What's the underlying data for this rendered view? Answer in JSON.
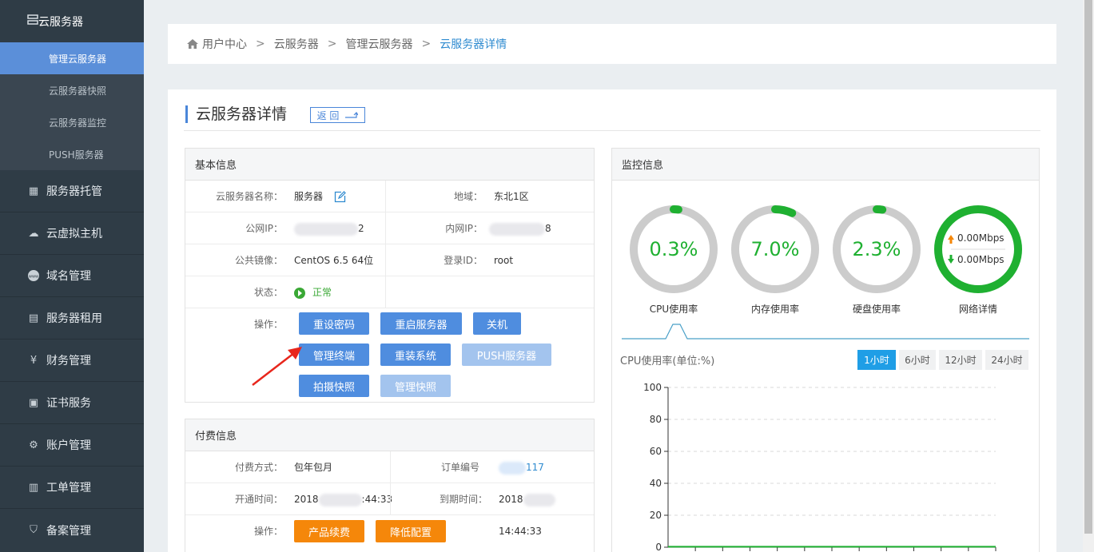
{
  "sidebar": {
    "top": {
      "label": "云服务器",
      "icon": "server-icon"
    },
    "subitems": [
      {
        "label": "管理云服务器",
        "active": true
      },
      {
        "label": "云服务器快照",
        "active": false
      },
      {
        "label": "云服务器监控",
        "active": false
      },
      {
        "label": "PUSH服务器",
        "active": false
      }
    ],
    "groups": [
      {
        "label": "服务器托管",
        "icon": "rack-icon"
      },
      {
        "label": "云虚拟主机",
        "icon": "cloud-host-icon"
      },
      {
        "label": "域名管理",
        "icon": "www-icon"
      },
      {
        "label": "服务器租用",
        "icon": "rent-icon"
      },
      {
        "label": "财务管理",
        "icon": "yen-icon"
      },
      {
        "label": "证书服务",
        "icon": "certificate-icon"
      },
      {
        "label": "账户管理",
        "icon": "gear-icon"
      },
      {
        "label": "工单管理",
        "icon": "clipboard-icon"
      },
      {
        "label": "备案管理",
        "icon": "shield-icon"
      }
    ]
  },
  "breadcrumb": {
    "items": [
      "用户中心",
      "云服务器",
      "管理云服务器"
    ],
    "separator": ">",
    "current": "云服务器详情"
  },
  "page": {
    "title": "云服务器详情",
    "back_label": "返 回"
  },
  "basic": {
    "header": "基本信息",
    "name_label": "云服务器名称：",
    "name_value": "服务器",
    "region_label": "地域：",
    "region_value": "东北1区",
    "public_ip_label": "公网IP：",
    "public_ip_suffix": "2",
    "private_ip_label": "内网IP：",
    "private_ip_suffix": "8",
    "image_label": "公共镜像：",
    "image_value": "CentOS 6.5 64位",
    "login_label": "登录ID：",
    "login_value": "root",
    "status_label": "状态：",
    "status_value": "正常",
    "ops_label": "操作：",
    "buttons": {
      "reset_password": "重设密码",
      "restart": "重启服务器",
      "shutdown": "关机",
      "terminal": "管理终端",
      "reinstall": "重装系统",
      "push": "PUSH服务器",
      "snapshot": "拍摄快照",
      "manage_snapshot": "管理快照"
    }
  },
  "billing": {
    "header": "付费信息",
    "method_label": "付费方式：",
    "method_value": "包年包月",
    "order_label": "订单编号",
    "order_suffix": "117",
    "open_label": "开通时间：",
    "open_prefix": "2018",
    "open_suffix": ":44:33",
    "expire_label": "到期时间：",
    "expire_prefix": "2018",
    "expire_suffix": "14:44:33",
    "ops_label": "操作：",
    "renew": "产品续费",
    "downgrade": "降低配置"
  },
  "monitor": {
    "header": "监控信息",
    "gauges": [
      {
        "value": "0.3%",
        "label": "CPU使用率",
        "fraction": 0.003
      },
      {
        "value": "7.0%",
        "label": "内存使用率",
        "fraction": 0.07
      },
      {
        "value": "2.3%",
        "label": "硬盘使用率",
        "fraction": 0.023
      }
    ],
    "network": {
      "up": "0.00Mbps",
      "down": "0.00Mbps",
      "label": "网络详情"
    },
    "chart_title": "CPU使用率(单位:%)",
    "ranges": [
      {
        "label": "1小时",
        "active": true
      },
      {
        "label": "6小时",
        "active": false
      },
      {
        "label": "12小时",
        "active": false
      },
      {
        "label": "24小时",
        "active": false
      }
    ]
  },
  "colors": {
    "accent": "#4f8ddf",
    "gauge_green": "#1fb031",
    "orange": "#f5870a",
    "sidebar": "#2f3c46"
  },
  "chart_data": {
    "type": "line",
    "title": "CPU使用率(单位:%)",
    "ylim": [
      0,
      100
    ],
    "yticks": [
      "100",
      "80",
      "60",
      "40",
      "20",
      "0"
    ],
    "series": [
      {
        "values": [
          0.3,
          0.3,
          0.3,
          0.3,
          0.3,
          0.3,
          0.3,
          0.3,
          0.3,
          0.3,
          0.3,
          0.3
        ]
      }
    ],
    "grid": true
  }
}
